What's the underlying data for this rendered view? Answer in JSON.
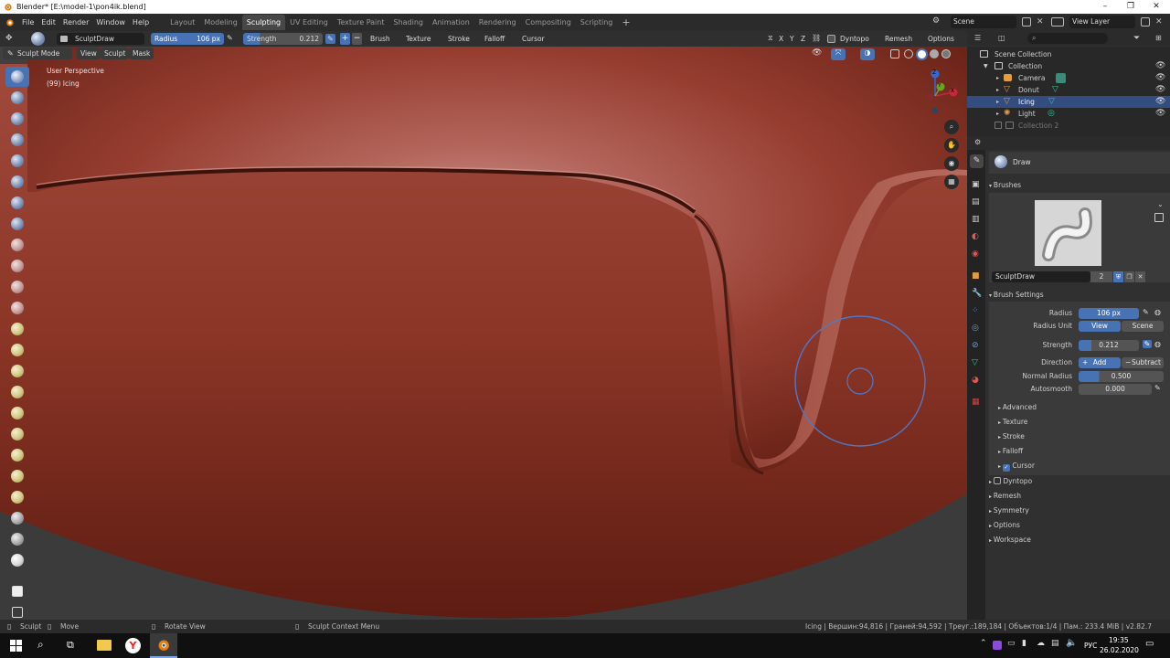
{
  "window": {
    "title": "Blender* [E:\\model-1\\pon4ik.blend]",
    "controls": [
      "–",
      "❐",
      "✕"
    ]
  },
  "menus": [
    "File",
    "Edit",
    "Render",
    "Window",
    "Help"
  ],
  "workspace_tabs": [
    {
      "label": "Layout",
      "active": false
    },
    {
      "label": "Modeling",
      "active": false
    },
    {
      "label": "Sculpting",
      "active": true
    },
    {
      "label": "UV Editing",
      "active": false
    },
    {
      "label": "Texture Paint",
      "active": false
    },
    {
      "label": "Shading",
      "active": false
    },
    {
      "label": "Animation",
      "active": false
    },
    {
      "label": "Rendering",
      "active": false
    },
    {
      "label": "Compositing",
      "active": false
    },
    {
      "label": "Scripting",
      "active": false
    }
  ],
  "scene": {
    "label": "Scene",
    "view_layer": "View Layer"
  },
  "toolheader": {
    "brush_name": "SculptDraw",
    "radius_label": "Radius",
    "radius_value": "106 px",
    "strength_label": "Strength",
    "strength_value": "0.212",
    "dropdowns": [
      "Brush",
      "Texture",
      "Stroke",
      "Falloff",
      "Cursor"
    ],
    "axes": [
      "X",
      "Y",
      "Z"
    ],
    "dyntopo": "Dyntopo",
    "remesh": "Remesh",
    "options": "Options"
  },
  "modeheader": {
    "mode": "Sculpt Mode",
    "items": [
      "View",
      "Sculpt",
      "Mask"
    ]
  },
  "viewport": {
    "perspective": "User Perspective",
    "object_info": "(99) Icing",
    "gizmo_axes": [
      "Z",
      "Y",
      "X"
    ]
  },
  "outliner": {
    "scene_collection": "Scene Collection",
    "items": [
      {
        "label": "Collection",
        "icon": "collection-icon",
        "indent": 1,
        "selected": false
      },
      {
        "label": "Camera",
        "icon": "camera-icon",
        "indent": 2,
        "selected": false
      },
      {
        "label": "Donut",
        "icon": "mesh-icon",
        "indent": 2,
        "selected": false
      },
      {
        "label": "Icing",
        "icon": "mesh-icon",
        "indent": 2,
        "selected": true
      },
      {
        "label": "Light",
        "icon": "light-icon",
        "indent": 2,
        "selected": false
      },
      {
        "label": "Collection 2",
        "icon": "collection-icon",
        "indent": 1,
        "selected": false
      }
    ]
  },
  "properties": {
    "tool_name": "Draw",
    "brushes_header": "Brushes",
    "brush_slot_name": "SculptDraw",
    "brush_users": "2",
    "brush_settings_header": "Brush Settings",
    "radius_label": "Radius",
    "radius_value": "106 px",
    "radius_unit_label": "Radius Unit",
    "radius_unit_view": "View",
    "radius_unit_scene": "Scene",
    "strength_label": "Strength",
    "strength_value": "0.212",
    "direction_label": "Direction",
    "direction_add": "Add",
    "direction_subtract": "Subtract",
    "normal_radius_label": "Normal Radius",
    "normal_radius_value": "0.500",
    "autosmooth_label": "Autosmooth",
    "autosmooth_value": "0.000",
    "subsections": [
      "Advanced",
      "Texture",
      "Stroke",
      "Falloff",
      "Cursor"
    ],
    "sections": [
      "Dyntopo",
      "Remesh",
      "Symmetry",
      "Options",
      "Workspace"
    ]
  },
  "statusbar": {
    "sculpt": "Sculpt",
    "move": "Move",
    "rotate": "Rotate View",
    "context": "Sculpt Context Menu",
    "stats": "Icing | Вершин:94,816 | Граней:94,592 | Треуг.:189,184 | Объектов:1/4 | Пам.: 233.4 MiB | v2.82.7"
  },
  "taskbar": {
    "lang": "РУС",
    "time": "19:35",
    "date": "26.02.2020"
  },
  "colors": {
    "accent": "#4772b3",
    "header": "#2b2b2b",
    "icing": "#a34a3c"
  }
}
